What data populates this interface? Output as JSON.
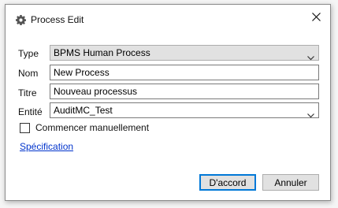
{
  "window": {
    "title": "Process Edit",
    "icon": "gear-icon",
    "close_icon": "close-icon"
  },
  "form": {
    "type": {
      "label": "Type",
      "value": "BPMS Human Process"
    },
    "nom": {
      "label": "Nom",
      "value": "New Process"
    },
    "titre": {
      "label": "Titre",
      "value": "Nouveau processus"
    },
    "entite": {
      "label": "Entité",
      "value": "AuditMC_Test"
    },
    "manual_start": {
      "label": "Commencer manuellement",
      "checked": false
    },
    "spec_link": "Spécification"
  },
  "buttons": {
    "ok": "D'accord",
    "cancel": "Annuler"
  },
  "colors": {
    "accent": "#0078d7",
    "link": "#0033cc",
    "button_face": "#e1e1e1"
  }
}
